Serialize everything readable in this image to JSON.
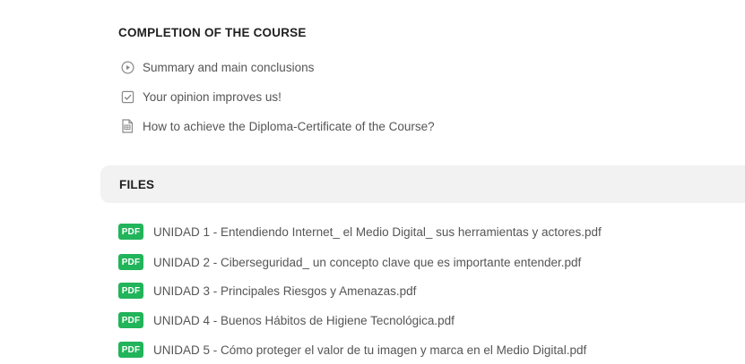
{
  "completion": {
    "title": "COMPLETION OF THE COURSE",
    "items": [
      {
        "label": "Summary and main conclusions",
        "icon": "play-circle-icon"
      },
      {
        "label": "Your opinion improves us!",
        "icon": "checkbox-icon"
      },
      {
        "label": "How to achieve the Diploma-Certificate of the Course?",
        "icon": "document-icon"
      }
    ]
  },
  "files": {
    "title": "FILES",
    "badge": "PDF",
    "badge_color": "#21b45a",
    "items": [
      {
        "name": "UNIDAD 1 - Entendiendo Internet_ el Medio Digital_ sus herramientas y actores.pdf"
      },
      {
        "name": "UNIDAD 2 - Ciberseguridad_ un concepto clave que es importante entender.pdf"
      },
      {
        "name": "UNIDAD 3 - Principales Riesgos y Amenazas.pdf"
      },
      {
        "name": "UNIDAD 4 - Buenos Hábitos de Higiene Tecnológica.pdf"
      },
      {
        "name": "UNIDAD 5 - Cómo proteger el valor de tu imagen y marca en el Medio Digital.pdf"
      }
    ]
  }
}
